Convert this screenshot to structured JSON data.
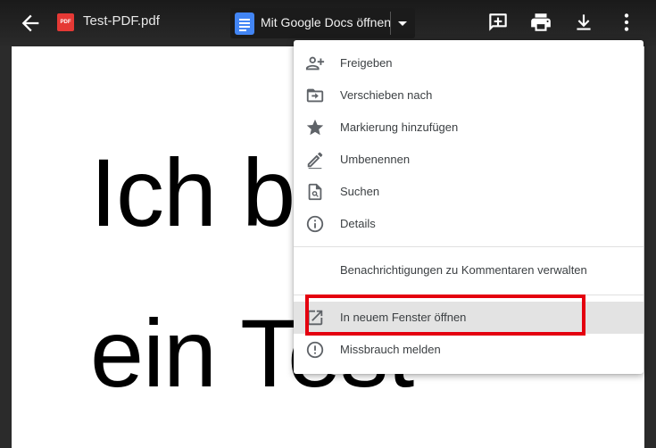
{
  "header": {
    "filename": "Test-PDF.pdf",
    "pdf_badge": "PDF",
    "open_with_label": "Mit Google Docs öffnen"
  },
  "document": {
    "line1": "Ich b",
    "line2": "ein Test"
  },
  "menu": {
    "items": [
      {
        "label": "Freigeben",
        "icon": "person-add-icon"
      },
      {
        "label": "Verschieben nach",
        "icon": "folder-move-icon"
      },
      {
        "label": "Markierung hinzufügen",
        "icon": "star-icon"
      },
      {
        "label": "Umbenennen",
        "icon": "pencil-icon"
      },
      {
        "label": "Suchen",
        "icon": "find-in-page-icon"
      },
      {
        "label": "Details",
        "icon": "info-icon"
      },
      {
        "label": "Benachrichtigungen zu Kommentaren verwalten",
        "icon": ""
      },
      {
        "label": "In neuem Fenster öffnen",
        "icon": "open-in-new-icon"
      },
      {
        "label": "Missbrauch melden",
        "icon": "report-icon"
      }
    ]
  },
  "colors": {
    "highlight_box": "#e4000f",
    "docs_blue": "#4285f4",
    "pdf_red": "#e53935"
  }
}
